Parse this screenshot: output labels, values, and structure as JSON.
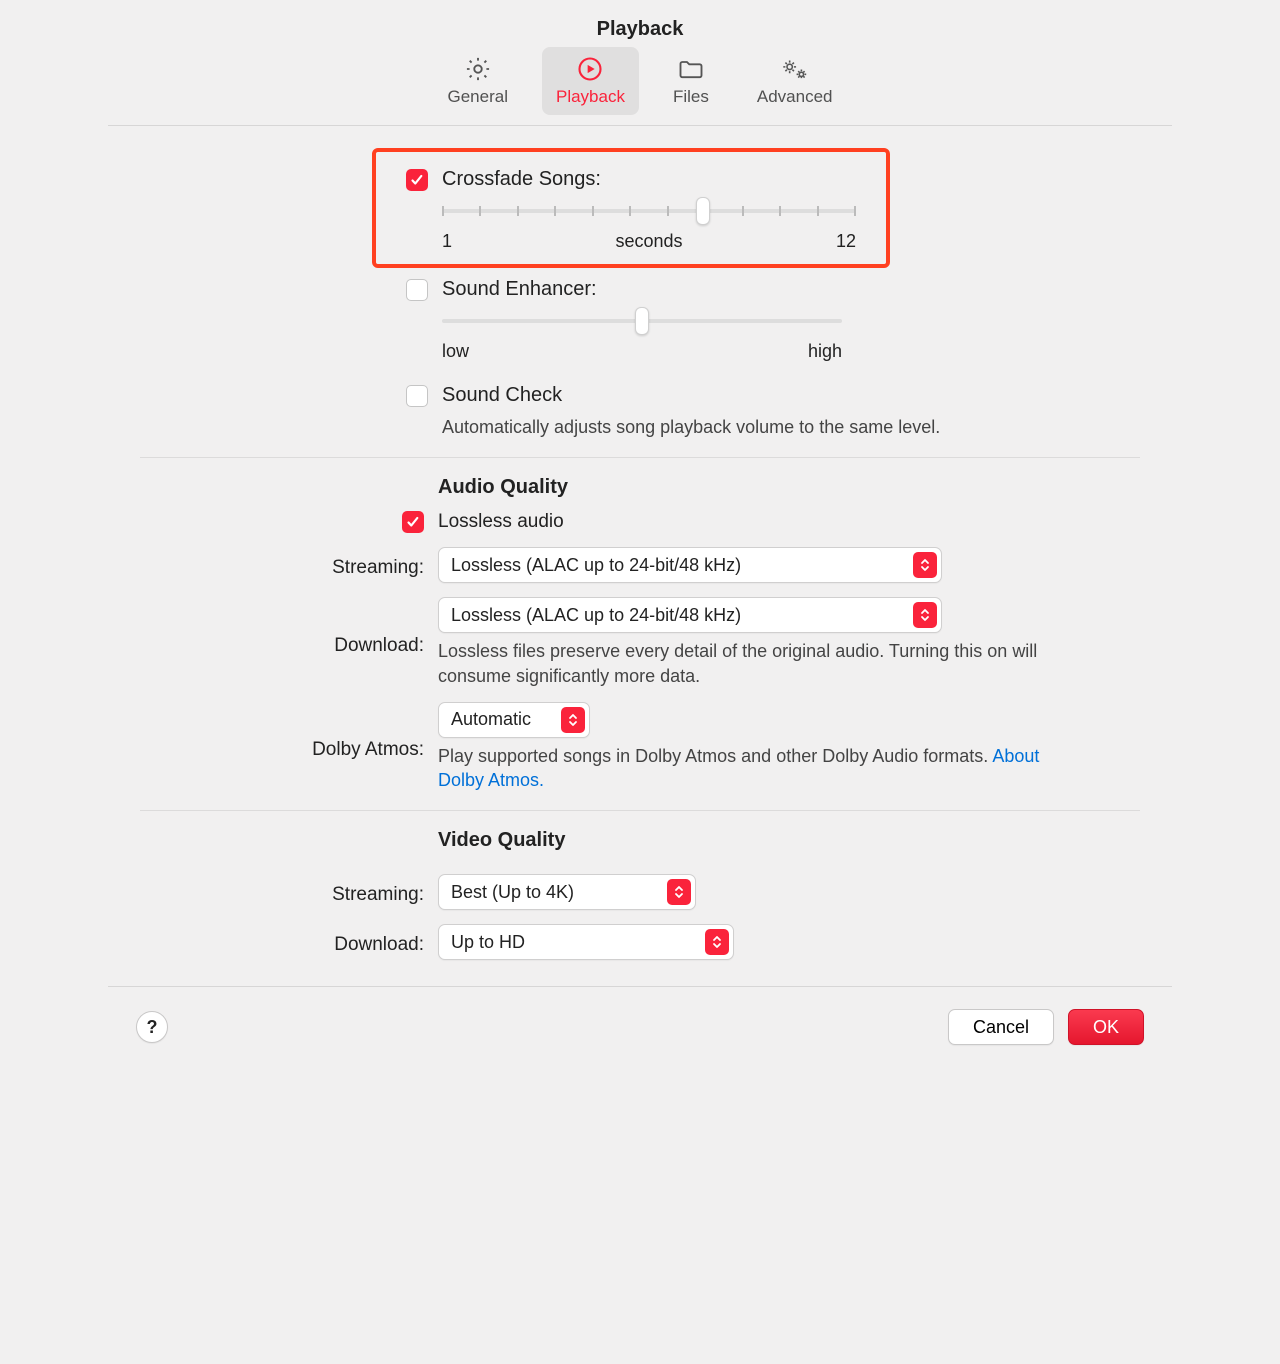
{
  "title": "Playback",
  "tabs": {
    "general": "General",
    "playback": "Playback",
    "files": "Files",
    "advanced": "Advanced"
  },
  "crossfade": {
    "label": "Crossfade Songs:",
    "checked": true,
    "min_label": "1",
    "max_label": "12",
    "unit": "seconds",
    "thumb_percent": 63
  },
  "enhancer": {
    "label": "Sound Enhancer:",
    "checked": false,
    "low": "low",
    "high": "high",
    "thumb_percent": 50
  },
  "soundcheck": {
    "label": "Sound Check",
    "checked": false,
    "desc": "Automatically adjusts song playback volume to the same level."
  },
  "audio": {
    "heading": "Audio Quality",
    "lossless_checked": true,
    "lossless_label": "Lossless audio",
    "streaming_label": "Streaming:",
    "streaming_value": "Lossless (ALAC up to 24-bit/48 kHz)",
    "download_label": "Download:",
    "download_value": "Lossless (ALAC up to 24-bit/48 kHz)",
    "lossless_desc": "Lossless files preserve every detail of the original audio. Turning this on will consume significantly more data.",
    "dolby_label": "Dolby Atmos:",
    "dolby_value": "Automatic",
    "dolby_desc": "Play supported songs in Dolby Atmos and other Dolby Audio formats. ",
    "dolby_link": "About Dolby Atmos."
  },
  "video": {
    "heading": "Video Quality",
    "streaming_label": "Streaming:",
    "streaming_value": "Best (Up to 4K)",
    "download_label": "Download:",
    "download_value": "Up to HD"
  },
  "footer": {
    "help": "?",
    "cancel": "Cancel",
    "ok": "OK"
  }
}
